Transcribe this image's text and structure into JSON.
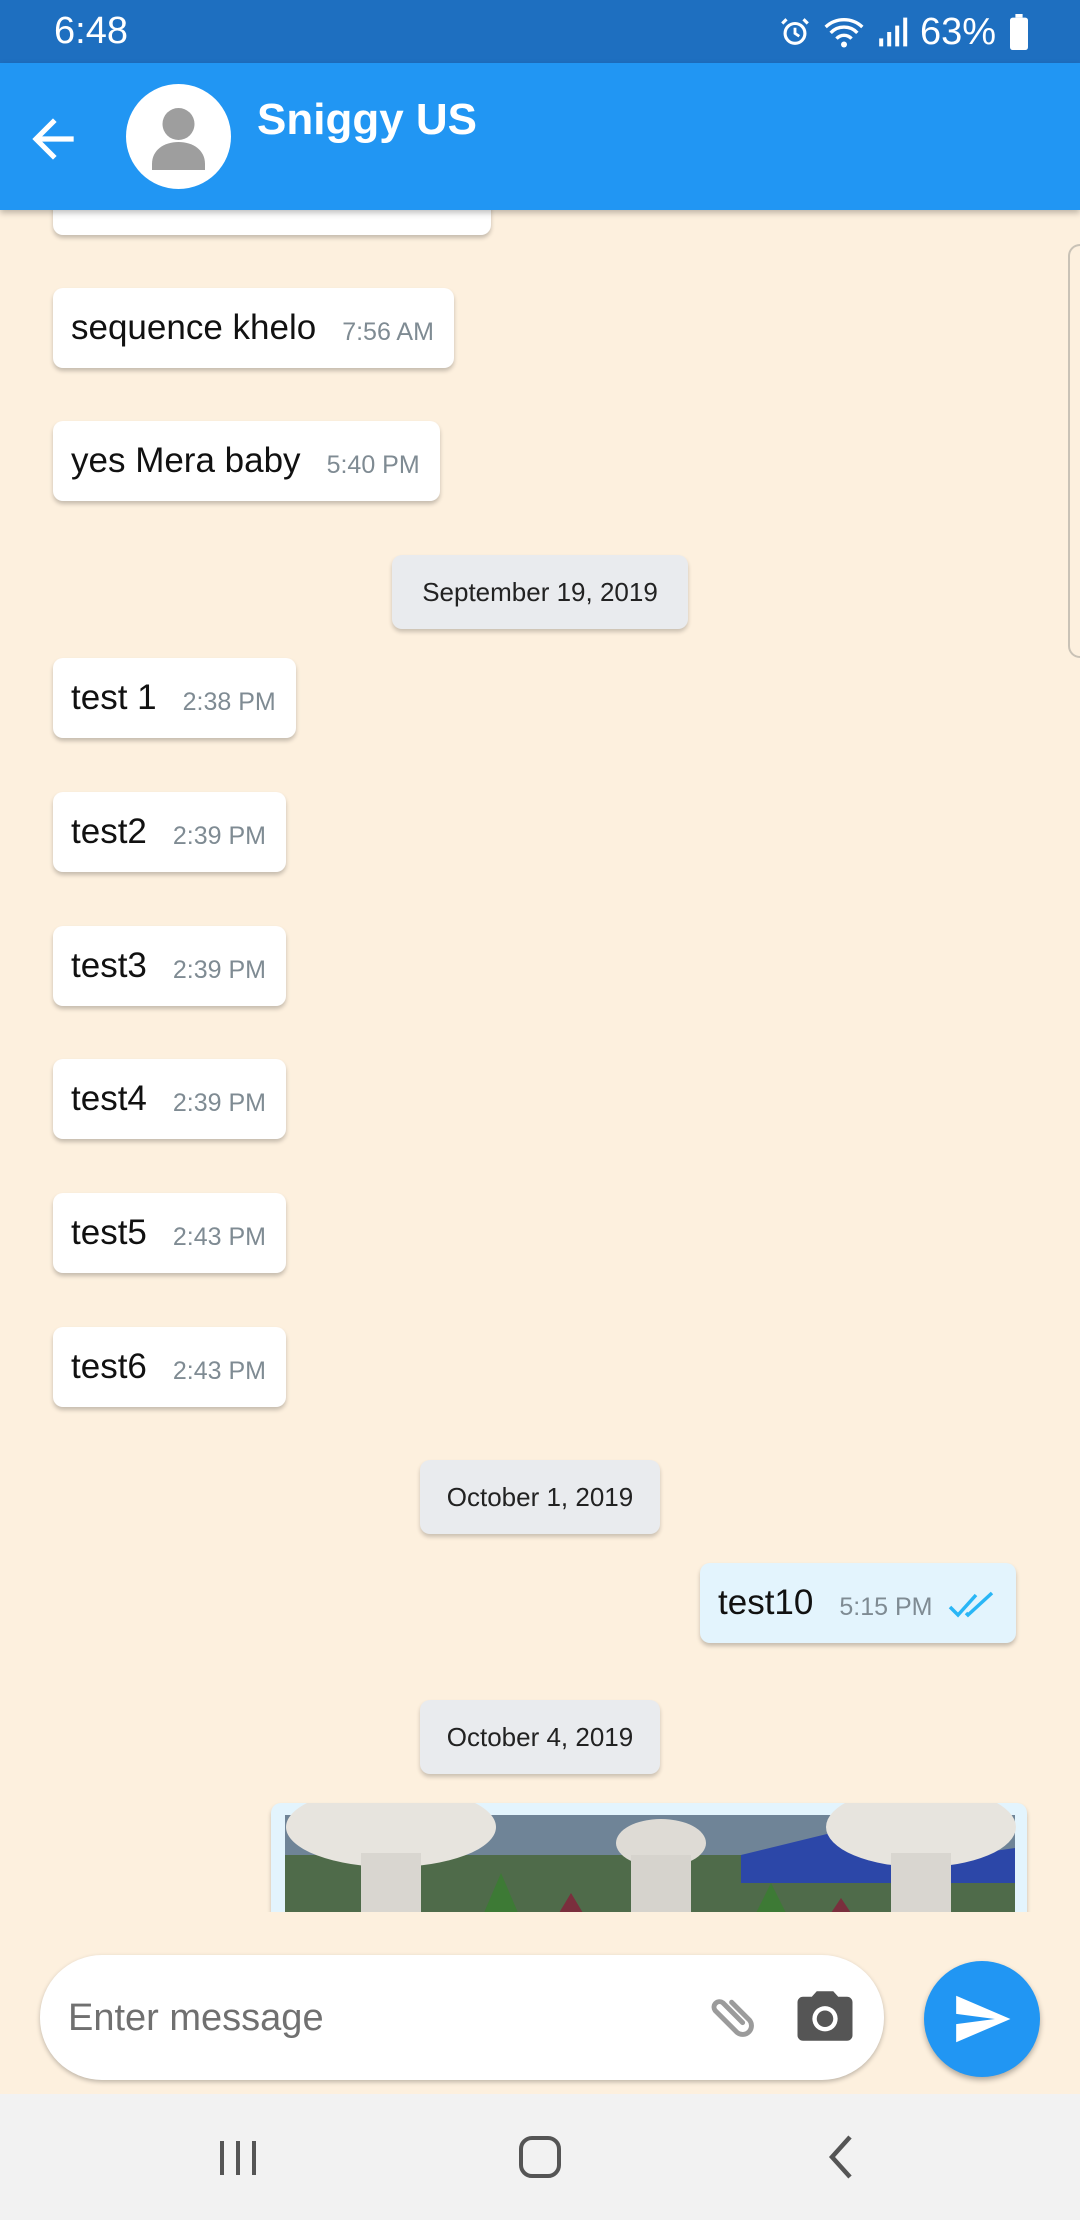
{
  "status_bar": {
    "time": "6:48",
    "battery": "63%",
    "icons": [
      "alarm-icon",
      "wifi-icon",
      "signal-icon",
      "battery-icon"
    ]
  },
  "header": {
    "contact_name": "Sniggy US",
    "back_icon": "arrow-left-icon",
    "avatar_icon": "person-icon"
  },
  "messages": [
    {
      "text": "sequence khelo",
      "time": "7:56 AM",
      "direction": "incoming"
    },
    {
      "text": "yes Mera baby",
      "time": "5:40 PM",
      "direction": "incoming"
    },
    {
      "date": "September 19, 2019"
    },
    {
      "text": "test 1",
      "time": "2:38 PM",
      "direction": "incoming"
    },
    {
      "text": "test2",
      "time": "2:39 PM",
      "direction": "incoming"
    },
    {
      "text": "test3",
      "time": "2:39 PM",
      "direction": "incoming"
    },
    {
      "text": "test4",
      "time": "2:39 PM",
      "direction": "incoming"
    },
    {
      "text": "test5",
      "time": "2:43 PM",
      "direction": "incoming"
    },
    {
      "text": "test6",
      "time": "2:43 PM",
      "direction": "incoming"
    },
    {
      "date": "October 1, 2019"
    },
    {
      "text": "test10",
      "time": "5:15 PM",
      "direction": "outgoing",
      "status": "read"
    },
    {
      "date": "October 4, 2019"
    },
    {
      "type": "image",
      "direction": "outgoing"
    }
  ],
  "composer": {
    "placeholder": "Enter message",
    "attach_icon": "paperclip-icon",
    "camera_icon": "camera-icon",
    "send_icon": "send-icon"
  },
  "colors": {
    "app_bar": "#2196f3",
    "status_bar": "#1e6fc0",
    "chat_background": "#fdf0de",
    "outgoing_bubble": "#e3f4fd",
    "read_ticks": "#29b6f6"
  }
}
